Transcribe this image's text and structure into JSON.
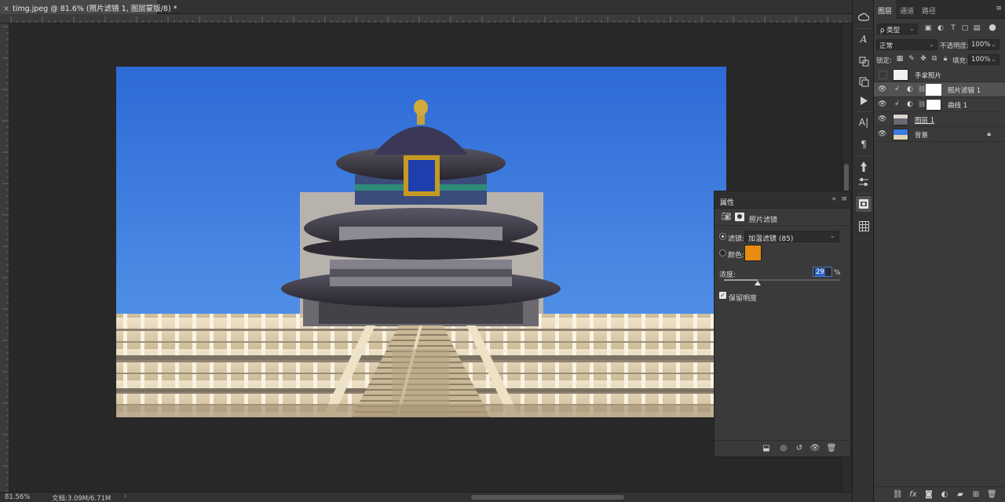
{
  "document": {
    "tab_title": "timg.jpeg @ 81.6% (照片滤镜 1, 图层蒙版/8) *",
    "close_glyph": "×"
  },
  "status": {
    "zoom": "81.56%",
    "doc_info": "文档:3.09M/6.71M",
    "arrow": "›"
  },
  "layers_panel": {
    "tabs": [
      "图层",
      "通道",
      "路径"
    ],
    "menu_glyph": "≡",
    "filter_kind": "ρ 类型",
    "blend_mode": "正常",
    "opacity_label": "不透明度:",
    "opacity_value": "100%",
    "lock_label": "锁定:",
    "fill_label": "填充:",
    "fill_value": "100%",
    "layers": [
      {
        "name": "手拿照片",
        "visible": false
      },
      {
        "name": "照片滤镜 1",
        "visible": true
      },
      {
        "name": "曲线 1",
        "visible": true
      },
      {
        "name": "图层 1",
        "visible": true
      },
      {
        "name": "背景",
        "visible": true
      }
    ]
  },
  "properties_panel": {
    "title": "属性",
    "collapse_glyph": "»",
    "menu_glyph": "≡",
    "adjustment_name": "照片滤镜",
    "filter_label": "滤镜:",
    "filter_value": "加温滤镜 (85)",
    "color_label": "颜色:",
    "color_value": "#e88b10",
    "density_label": "浓度:",
    "density_value": "29",
    "density_unit": "%",
    "density_percent": 29,
    "preserve_label": "保留明度"
  },
  "colors": {
    "sky_top": "#2f6fd9",
    "sky_bottom": "#5a9cec",
    "photo_overlay": "#b8b2ad"
  }
}
